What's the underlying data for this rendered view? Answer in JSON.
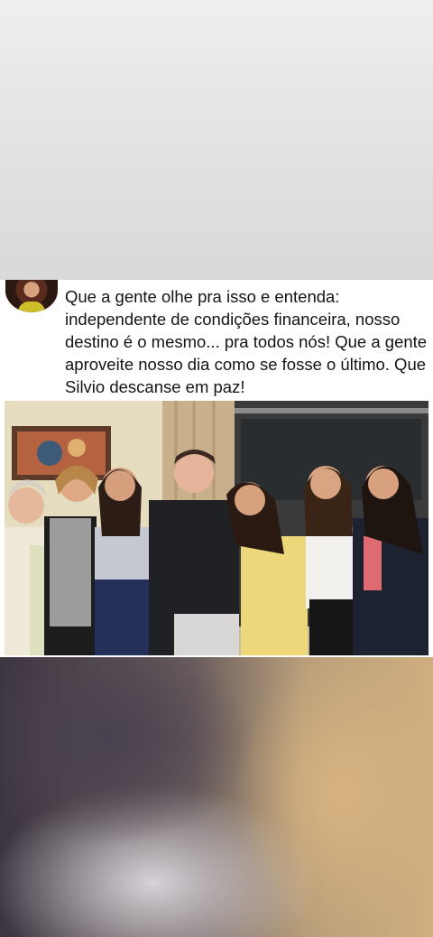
{
  "post": {
    "text": "Que a gente olhe pra isso e entenda: independente de condições financeira, nosso destino é o mesmo... pra todos nós! Que a gente aproveite nosso dia como se fosse o último. Que Silvio descanse em paz!"
  },
  "photo": {
    "description_icon": "group-photo-image"
  }
}
